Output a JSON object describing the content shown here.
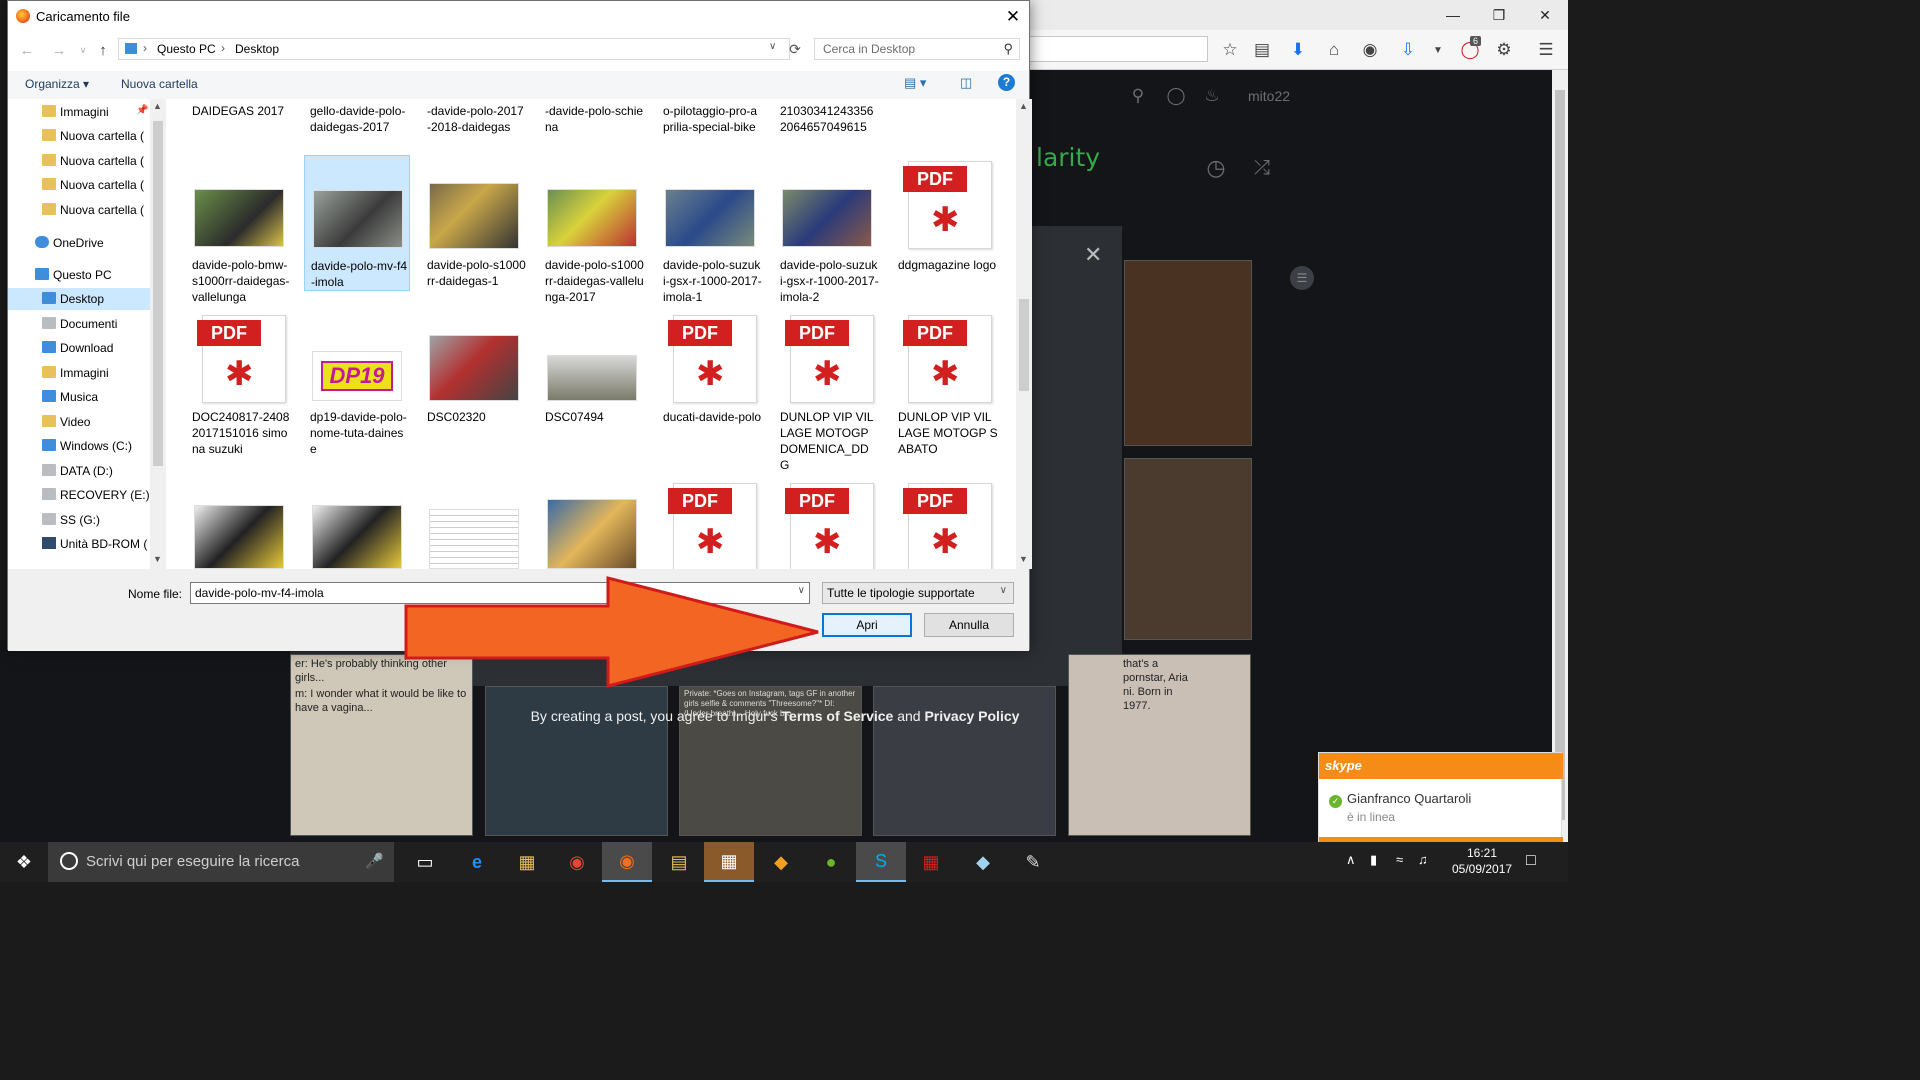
{
  "dialog": {
    "title": "Caricamento file",
    "breadcrumb": [
      "Questo PC",
      "Desktop"
    ],
    "search_placeholder": "Cerca in Desktop",
    "commands": {
      "organize": "Organizza",
      "new_folder": "Nuova cartella"
    },
    "nav_items": [
      {
        "label": "Immagini",
        "icon": "pictures-icon"
      },
      {
        "label": "Nuova cartella (",
        "icon": "folder-icon"
      },
      {
        "label": "Nuova cartella (",
        "icon": "folder-icon"
      },
      {
        "label": "Nuova cartella (",
        "icon": "folder-icon"
      },
      {
        "label": "Nuova cartella (",
        "icon": "folder-icon"
      },
      {
        "label": "OneDrive",
        "icon": "onedrive-icon"
      },
      {
        "label": "Questo PC",
        "icon": "pc-icon"
      },
      {
        "label": "Desktop",
        "icon": "desktop-icon",
        "selected": true
      },
      {
        "label": "Documenti",
        "icon": "documents-icon"
      },
      {
        "label": "Download",
        "icon": "download-icon"
      },
      {
        "label": "Immagini",
        "icon": "pictures-icon"
      },
      {
        "label": "Musica",
        "icon": "music-icon"
      },
      {
        "label": "Video",
        "icon": "video-icon"
      },
      {
        "label": "Windows (C:)",
        "icon": "drive-icon"
      },
      {
        "label": "DATA (D:)",
        "icon": "drive-icon"
      },
      {
        "label": "RECOVERY (E:)",
        "icon": "drive-icon"
      },
      {
        "label": "SS (G:)",
        "icon": "sd-card-icon"
      },
      {
        "label": "Unità BD-ROM (",
        "icon": "bd-rom-icon"
      }
    ],
    "top_row": [
      "DAIDEGAS 2017",
      "gello-davide-polo-daidegas-2017",
      "-davide-polo-2017-2018-daidegas",
      "-davide-polo-schiena",
      "o-pilotaggio-pro-aprilia-special-bike",
      "210303412433562064657049615"
    ],
    "row2": [
      {
        "name": "davide-polo-bmw-s1000rr-daidegas-vallelunga",
        "type": "image"
      },
      {
        "name": "davide-polo-mv-f4-imola",
        "type": "image",
        "selected": true
      },
      {
        "name": "davide-polo-s1000rr-daidegas-1",
        "type": "image"
      },
      {
        "name": "davide-polo-s1000rr-daidegas-vallelunga-2017",
        "type": "image"
      },
      {
        "name": "davide-polo-suzuki-gsx-r-1000-2017-imola-1",
        "type": "image"
      },
      {
        "name": "davide-polo-suzuki-gsx-r-1000-2017-imola-2",
        "type": "image"
      },
      {
        "name": "ddgmagazine logo",
        "type": "pdf"
      }
    ],
    "row3": [
      {
        "name": "DOC240817-24082017151016 simona suzuki",
        "type": "pdf"
      },
      {
        "name": "dp19-davide-polo-nome-tuta-dainese",
        "type": "logo"
      },
      {
        "name": "DSC02320",
        "type": "image"
      },
      {
        "name": "DSC07494",
        "type": "image"
      },
      {
        "name": "ducati-davide-polo",
        "type": "pdf"
      },
      {
        "name": "DUNLOP VIP VILLAGE MOTOGP DOMENICA_DDG",
        "type": "pdf"
      },
      {
        "name": "DUNLOP VIP VILLAGE MOTOGP SABATO",
        "type": "pdf"
      }
    ],
    "row4_types": [
      "image",
      "image",
      "doc",
      "image",
      "pdf",
      "pdf",
      "pdf"
    ],
    "pdf_badge": "PDF",
    "logo_text": "DP19",
    "filename_label": "Nome file:",
    "filename_value": "davide-polo-mv-f4-imola",
    "filetype": "Tutte le tipologie supportate",
    "open": "Apri",
    "cancel": "Annulla"
  },
  "browser": {
    "user": "mito22",
    "badge": "6",
    "section": "larity"
  },
  "imgur": {
    "terms_prefix": "By creating a post, you agree to Imgur's ",
    "terms_link": "Terms of Service",
    "and": " and ",
    "privacy_link": "Privacy Policy",
    "meme_left_1": "er: He's probably thinking other girls...",
    "meme_left_2": "m: I wonder what it would be like to have a vagina...",
    "meme_mid": "Private: *Goes on Instagram, tags GF in another girls selfie & comments \"Threesome?\"* DI: (Under breath)... Holy fuck bro",
    "meme_right": "that's a pornstar, Aria ni. Born in 1977."
  },
  "skype": {
    "brand": "skype",
    "name": "Gianfranco  Quartaroli",
    "status": "è in linea"
  },
  "taskbar": {
    "search_placeholder": "Scrivi qui per eseguire la ricerca",
    "time": "16:21",
    "date": "05/09/2017"
  },
  "colors": {
    "accent": "#0078d7",
    "arrow": "#f26522",
    "skype": "#f58c18",
    "pdf": "#d1201f"
  }
}
